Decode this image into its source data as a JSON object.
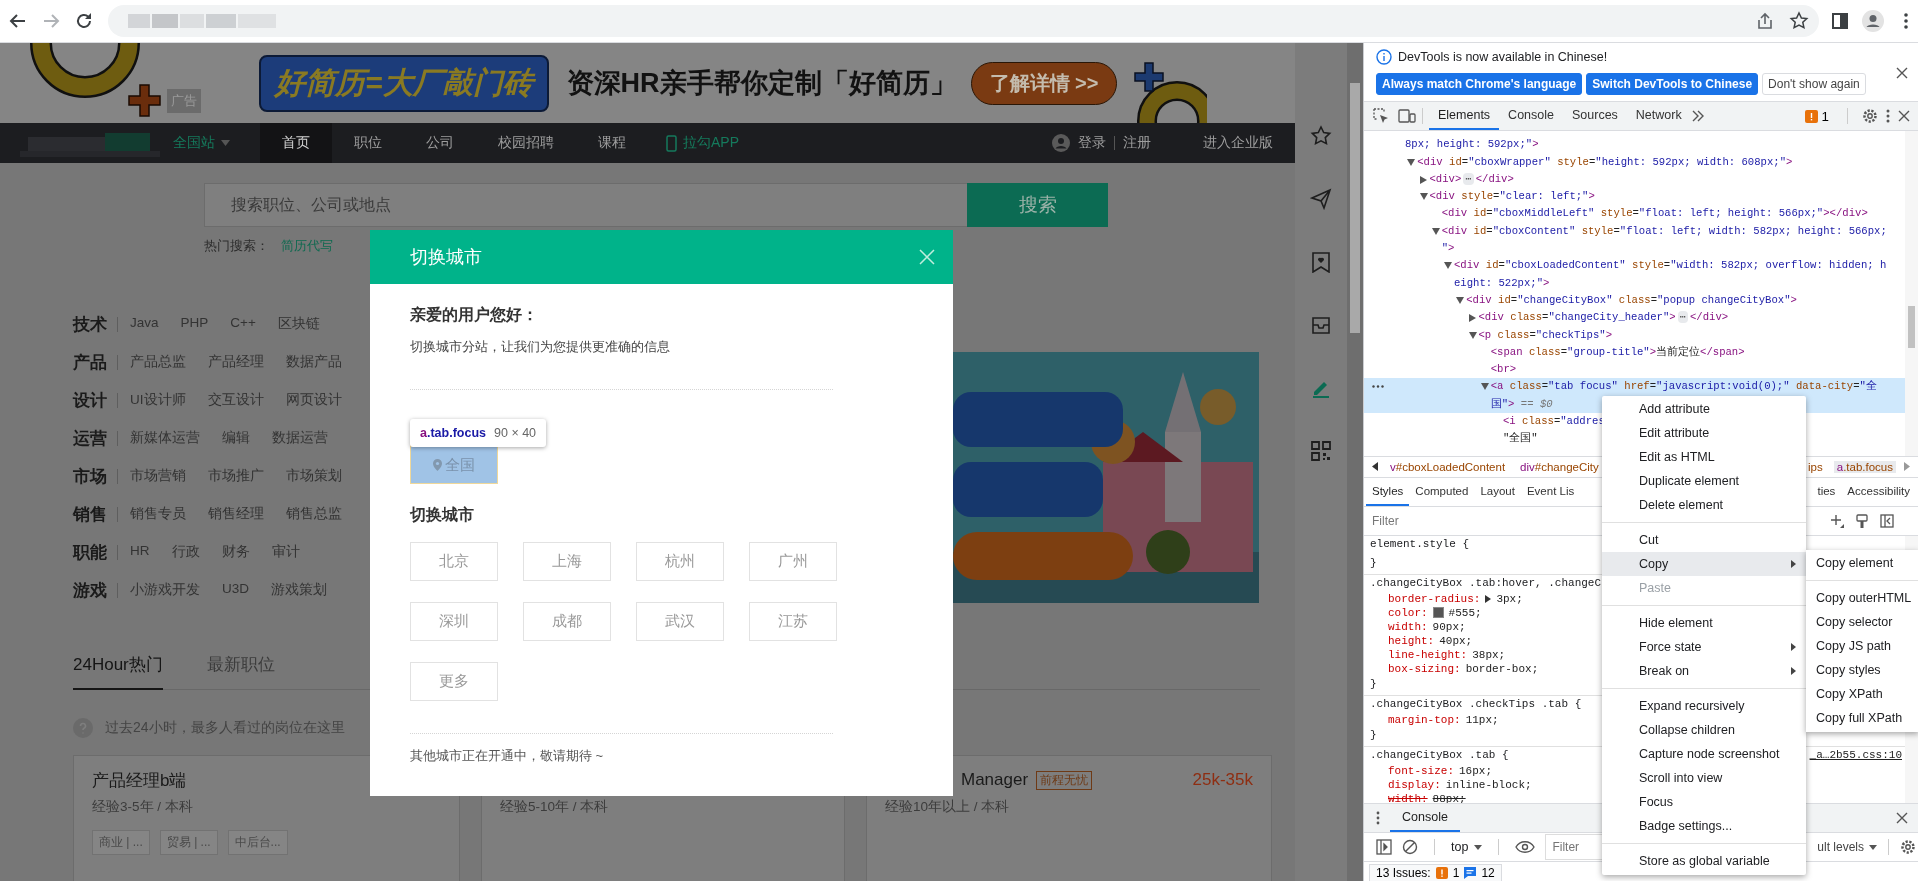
{
  "ad_banner": {
    "badge": "广告",
    "slogan": "好简历=大厂敲门砖",
    "headline": "资深HR亲手帮你定制「好简历」",
    "cta": "了解详情 >>"
  },
  "nav": {
    "city": {
      "label": "全国站",
      "expanded": false
    },
    "items": [
      {
        "label": "首页",
        "selected": true
      },
      {
        "label": "职位",
        "selected": false
      },
      {
        "label": "公司",
        "selected": false
      },
      {
        "label": "校园招聘",
        "selected": false
      },
      {
        "label": "课程",
        "selected": false
      }
    ],
    "app_link": "拉勾APP",
    "login": "登录",
    "register": "注册",
    "enterprise": "进入企业版"
  },
  "search": {
    "placeholder": "搜索职位、公司或地点",
    "button": "搜索",
    "hot_label": "热门搜索：",
    "hot_terms": [
      "简历代写"
    ]
  },
  "categories": [
    {
      "name": "技术",
      "items": [
        "Java",
        "PHP",
        "C++",
        "区块链"
      ]
    },
    {
      "name": "产品",
      "items": [
        "产品总监",
        "产品经理",
        "数据产品"
      ]
    },
    {
      "name": "设计",
      "items": [
        "UI设计师",
        "交互设计",
        "网页设计"
      ]
    },
    {
      "name": "运营",
      "items": [
        "新媒体运营",
        "编辑",
        "数据运营"
      ]
    },
    {
      "name": "市场",
      "items": [
        "市场营销",
        "市场推广",
        "市场策划"
      ]
    },
    {
      "name": "销售",
      "items": [
        "销售专员",
        "销售经理",
        "销售总监"
      ]
    },
    {
      "name": "职能",
      "items": [
        "HR",
        "行政",
        "财务",
        "审计"
      ]
    },
    {
      "name": "游戏",
      "items": [
        "小游戏开发",
        "U3D",
        "游戏策划"
      ]
    }
  ],
  "job_tabs": [
    {
      "label": "24Hour热门",
      "selected": true
    },
    {
      "label": "最新职位",
      "selected": false
    }
  ],
  "hot_tip": "过去24小时，最多人看过的岗位在这里",
  "jobs": [
    {
      "title": "产品经理b端",
      "experience": "经验3-5年 / 本科",
      "tags": [
        "商业 | ...",
        "贸易 | ...",
        "中后台..."
      ]
    },
    {
      "experience": "经验5-10年 / 本科"
    },
    {
      "title": "Manager",
      "source": "前程无忧",
      "salary": "25k-35k",
      "experience": "经验10年以上 / 本科"
    }
  ],
  "modal": {
    "title": "切换城市",
    "greeting": "亲爱的用户您好：",
    "intro": "切换城市分站，让我们为您提供更准确的信息",
    "current": {
      "label": "全国",
      "highlighted": true
    },
    "cities_title": "切换城市",
    "cities": [
      "北京",
      "上海",
      "杭州",
      "广州",
      "深圳",
      "成都",
      "武汉",
      "江苏",
      "更多"
    ],
    "footer": "其他城市正在开通中，敬请期待 ~"
  },
  "inspect_tooltip": {
    "selector": "a.tab.focus",
    "size": "90 × 40"
  },
  "devtools": {
    "infobar": {
      "message": "DevTools is now available in Chinese!",
      "buttons": [
        {
          "label": "Always match Chrome's language",
          "kind": "primary"
        },
        {
          "label": "Switch DevTools to Chinese",
          "kind": "primary"
        },
        {
          "label": "Don't show again",
          "kind": "secondary"
        }
      ]
    },
    "tabs": [
      {
        "label": "Elements",
        "selected": true
      },
      {
        "label": "Console",
        "selected": false
      },
      {
        "label": "Sources",
        "selected": false
      },
      {
        "label": "Network",
        "selected": false
      }
    ],
    "issues_count": "1",
    "dom_tree": {
      "selected": false,
      "wrap": [
        {
          "kind": "value",
          "text": "8px; height: 592px;\""
        },
        {
          "kind": "tag",
          "text": ">"
        }
      ],
      "children": [
        {
          "selected": false,
          "expanded": true,
          "head": [
            {
              "kind": "tag",
              "text": "<div"
            },
            {
              "kind": "attr",
              "text": " id"
            },
            {
              "kind": "text",
              "text": "="
            },
            {
              "kind": "value",
              "text": "\"cboxWrapper\""
            },
            {
              "kind": "attr",
              "text": " style"
            },
            {
              "kind": "text",
              "text": "="
            },
            {
              "kind": "value",
              "text": "\"height: 592px; width: 608px;\""
            },
            {
              "kind": "tag",
              "text": ">"
            }
          ],
          "children": [
            {
              "selected": false,
              "expanded": false,
              "head": [
                {
                  "kind": "tag",
                  "text": "<div>"
                },
                {
                  "kind": "ellipsis",
                  "text": "⋯"
                },
                {
                  "kind": "tag",
                  "text": "</div>"
                }
              ]
            },
            {
              "selected": false,
              "expanded": true,
              "head": [
                {
                  "kind": "tag",
                  "text": "<div"
                },
                {
                  "kind": "attr",
                  "text": " style"
                },
                {
                  "kind": "text",
                  "text": "="
                },
                {
                  "kind": "value",
                  "text": "\"clear: left;\""
                },
                {
                  "kind": "tag",
                  "text": ">"
                }
              ],
              "children": [
                {
                  "selected": false,
                  "head": [
                    {
                      "kind": "tag",
                      "text": "<div"
                    },
                    {
                      "kind": "attr",
                      "text": " id"
                    },
                    {
                      "kind": "text",
                      "text": "="
                    },
                    {
                      "kind": "value",
                      "text": "\"cboxMiddleLeft\""
                    },
                    {
                      "kind": "attr",
                      "text": " style"
                    },
                    {
                      "kind": "text",
                      "text": "="
                    },
                    {
                      "kind": "value",
                      "text": "\"float: left; height: 566px;\""
                    },
                    {
                      "kind": "tag",
                      "text": "></div>"
                    }
                  ]
                },
                {
                  "selected": false,
                  "expanded": true,
                  "head": [
                    {
                      "kind": "tag",
                      "text": "<div"
                    },
                    {
                      "kind": "attr",
                      "text": " id"
                    },
                    {
                      "kind": "text",
                      "text": "="
                    },
                    {
                      "kind": "value",
                      "text": "\"cboxContent\""
                    },
                    {
                      "kind": "attr",
                      "text": " style"
                    },
                    {
                      "kind": "text",
                      "text": "="
                    },
                    {
                      "kind": "value",
                      "text": "\"float: left; width: 582px; height: 566px;"
                    }
                  ],
                  "wrap": [
                    {
                      "kind": "value",
                      "text": "\""
                    },
                    {
                      "kind": "tag",
                      "text": ">"
                    }
                  ],
                  "children": [
                    {
                      "selected": false,
                      "expanded": true,
                      "head": [
                        {
                          "kind": "tag",
                          "text": "<div"
                        },
                        {
                          "kind": "attr",
                          "text": " id"
                        },
                        {
                          "kind": "text",
                          "text": "="
                        },
                        {
                          "kind": "value",
                          "text": "\"cboxLoadedContent\""
                        },
                        {
                          "kind": "attr",
                          "text": " style"
                        },
                        {
                          "kind": "text",
                          "text": "="
                        },
                        {
                          "kind": "value",
                          "text": "\"width: 582px; overflow: hidden; h"
                        }
                      ],
                      "wrap": [
                        {
                          "kind": "value",
                          "text": "eight: 522px;\""
                        },
                        {
                          "kind": "tag",
                          "text": ">"
                        }
                      ],
                      "children": [
                        {
                          "selected": false,
                          "expanded": true,
                          "head": [
                            {
                              "kind": "tag",
                              "text": "<div"
                            },
                            {
                              "kind": "attr",
                              "text": " id"
                            },
                            {
                              "kind": "text",
                              "text": "="
                            },
                            {
                              "kind": "value",
                              "text": "\"changeCityBox\""
                            },
                            {
                              "kind": "attr",
                              "text": " class"
                            },
                            {
                              "kind": "text",
                              "text": "="
                            },
                            {
                              "kind": "value",
                              "text": "\"popup changeCityBox\""
                            },
                            {
                              "kind": "tag",
                              "text": ">"
                            }
                          ],
                          "children": [
                            {
                              "selected": false,
                              "expanded": false,
                              "head": [
                                {
                                  "kind": "tag",
                                  "text": "<div"
                                },
                                {
                                  "kind": "attr",
                                  "text": " class"
                                },
                                {
                                  "kind": "text",
                                  "text": "="
                                },
                                {
                                  "kind": "value",
                                  "text": "\"changeCity_header\""
                                },
                                {
                                  "kind": "tag",
                                  "text": ">"
                                },
                                {
                                  "kind": "ellipsis",
                                  "text": "⋯"
                                },
                                {
                                  "kind": "tag",
                                  "text": "</div>"
                                }
                              ]
                            },
                            {
                              "selected": false,
                              "expanded": true,
                              "head": [
                                {
                                  "kind": "tag",
                                  "text": "<p"
                                },
                                {
                                  "kind": "attr",
                                  "text": " class"
                                },
                                {
                                  "kind": "text",
                                  "text": "="
                                },
                                {
                                  "kind": "value",
                                  "text": "\"checkTips\""
                                },
                                {
                                  "kind": "tag",
                                  "text": ">"
                                }
                              ],
                              "children": [
                                {
                                  "selected": false,
                                  "head": [
                                    {
                                      "kind": "tag",
                                      "text": "<span"
                                    },
                                    {
                                      "kind": "attr",
                                      "text": " class"
                                    },
                                    {
                                      "kind": "text",
                                      "text": "="
                                    },
                                    {
                                      "kind": "value",
                                      "text": "\"group-title\""
                                    },
                                    {
                                      "kind": "tag",
                                      "text": ">"
                                    },
                                    {
                                      "kind": "text",
                                      "text": "当前定位"
                                    },
                                    {
                                      "kind": "tag",
                                      "text": "</span>"
                                    }
                                  ]
                                },
                                {
                                  "selected": false,
                                  "head": [
                                    {
                                      "kind": "tag",
                                      "text": "<br>"
                                    }
                                  ]
                                },
                                {
                                  "selected": true,
                                  "expanded": true,
                                  "head": [
                                    {
                                      "kind": "tag",
                                      "text": "<a"
                                    },
                                    {
                                      "kind": "attr",
                                      "text": " class"
                                    },
                                    {
                                      "kind": "text",
                                      "text": "="
                                    },
                                    {
                                      "kind": "value",
                                      "text": "\"tab focus\""
                                    },
                                    {
                                      "kind": "attr",
                                      "text": " href"
                                    },
                                    {
                                      "kind": "text",
                                      "text": "="
                                    },
                                    {
                                      "kind": "value",
                                      "text": "\"javascript:void(0);\""
                                    },
                                    {
                                      "kind": "attr",
                                      "text": " data-city"
                                    },
                                    {
                                      "kind": "text",
                                      "text": "="
                                    },
                                    {
                                      "kind": "value",
                                      "text": "\"全"
                                    }
                                  ],
                                  "wrap": [
                                    {
                                      "kind": "value",
                                      "text": "国\""
                                    },
                                    {
                                      "kind": "tag",
                                      "text": ">"
                                    },
                                    {
                                      "kind": "comment",
                                      "text": " == $0"
                                    }
                                  ],
                                  "children": [
                                    {
                                      "selected": false,
                                      "head": [
                                        {
                                          "kind": "tag",
                                          "text": "<i"
                                        },
                                        {
                                          "kind": "attr",
                                          "text": " class"
                                        },
                                        {
                                          "kind": "text",
                                          "text": "="
                                        },
                                        {
                                          "kind": "value",
                                          "text": "\"addres"
                                        }
                                      ]
                                    },
                                    {
                                      "selected": false,
                                      "head": [
                                        {
                                          "kind": "text",
                                          "text": "\"全国\""
                                        }
                                      ]
                                    }
                                  ]
                                }
                              ]
                            }
                          ]
                        }
                      ]
                    }
                  ]
                }
              ]
            }
          ]
        }
      ]
    },
    "breadcrumbs": [
      {
        "label": "v#cboxLoadedContent",
        "selected": false
      },
      {
        "label": "div#changeCity",
        "selected": false
      },
      {
        "label": "ips",
        "selected": false
      },
      {
        "label": "a.tab.focus",
        "selected": true
      }
    ],
    "style_tabs": [
      {
        "label": "Styles",
        "selected": true
      },
      {
        "label": "Computed",
        "selected": false
      },
      {
        "label": "Layout",
        "selected": false
      },
      {
        "label": "Event Lis",
        "selected": false
      },
      {
        "label": "ties",
        "selected": false
      },
      {
        "label": "Accessibility",
        "selected": false
      }
    ],
    "styles_filter": {
      "placeholder": "Filter"
    },
    "rules": [
      {
        "selector": "element.style {",
        "close": "}"
      },
      {
        "selector": ".changeCityBox .tab:hover, .changeC",
        "close": "}",
        "declarations": [
          {
            "property": "border-radius:",
            "value": "3px;",
            "kind": "expandable",
            "overridden": false
          },
          {
            "property": "color:",
            "value": "#555;",
            "kind": "color",
            "overridden": false
          },
          {
            "property": "width:",
            "value": "90px;",
            "kind": "plain",
            "overridden": false
          },
          {
            "property": "height:",
            "value": "40px;",
            "kind": "plain",
            "overridden": false
          },
          {
            "property": "line-height:",
            "value": "38px;",
            "kind": "plain",
            "overridden": false
          },
          {
            "property": "box-sizing:",
            "value": "border-box;",
            "kind": "plain",
            "overridden": false
          }
        ]
      },
      {
        "selector": ".changeCityBox .checkTips .tab {",
        "close": "}",
        "declarations": [
          {
            "property": "margin-top:",
            "value": "11px;",
            "kind": "plain",
            "overridden": false
          }
        ]
      },
      {
        "selector": ".changeCityBox .tab {",
        "source": "_a…2b55.css:10",
        "declarations": [
          {
            "property": "font-size:",
            "value": "16px;",
            "kind": "plain",
            "overridden": false
          },
          {
            "property": "display:",
            "value": "inline-block;",
            "kind": "plain",
            "overridden": false
          },
          {
            "property": "width:",
            "value": "88px;",
            "kind": "plain",
            "overridden": true
          }
        ]
      }
    ],
    "console_drawer": {
      "tab": {
        "label": "Console",
        "selected": true
      },
      "context": "top",
      "filter_placeholder": "Filter",
      "levels": "ult levels",
      "issues": {
        "label": "13 Issues:",
        "warnings": "1",
        "infos": "12"
      }
    },
    "context_menu": {
      "groups": [
        [
          {
            "label": "Add attribute",
            "highlighted": false,
            "disabled": false,
            "submenu": false
          },
          {
            "label": "Edit attribute",
            "highlighted": false,
            "disabled": false,
            "submenu": false
          },
          {
            "label": "Edit as HTML",
            "highlighted": false,
            "disabled": false,
            "submenu": false
          },
          {
            "label": "Duplicate element",
            "highlighted": false,
            "disabled": false,
            "submenu": false
          },
          {
            "label": "Delete element",
            "highlighted": false,
            "disabled": false,
            "submenu": false
          }
        ],
        [
          {
            "label": "Cut",
            "highlighted": false,
            "disabled": false,
            "submenu": false
          },
          {
            "label": "Copy",
            "highlighted": true,
            "disabled": false,
            "submenu": true
          },
          {
            "label": "Paste",
            "highlighted": false,
            "disabled": true,
            "submenu": false
          }
        ],
        [
          {
            "label": "Hide element",
            "highlighted": false,
            "disabled": false,
            "submenu": false
          },
          {
            "label": "Force state",
            "highlighted": false,
            "disabled": false,
            "submenu": true
          },
          {
            "label": "Break on",
            "highlighted": false,
            "disabled": false,
            "submenu": true
          }
        ],
        [
          {
            "label": "Expand recursively",
            "highlighted": false,
            "disabled": false,
            "submenu": false
          },
          {
            "label": "Collapse children",
            "highlighted": false,
            "disabled": false,
            "submenu": false
          },
          {
            "label": "Capture node screenshot",
            "highlighted": false,
            "disabled": false,
            "submenu": false
          },
          {
            "label": "Scroll into view",
            "highlighted": false,
            "disabled": false,
            "submenu": false
          },
          {
            "label": "Focus",
            "highlighted": false,
            "disabled": false,
            "submenu": false
          },
          {
            "label": "Badge settings...",
            "highlighted": false,
            "disabled": false,
            "submenu": false
          }
        ],
        [
          {
            "label": "Store as global variable",
            "highlighted": false,
            "disabled": false,
            "submenu": false
          }
        ]
      ]
    },
    "submenu": {
      "groups": [
        [
          "Copy element"
        ],
        [
          "Copy outerHTML",
          "Copy selector",
          "Copy JS path",
          "Copy styles",
          "Copy XPath",
          "Copy full XPath"
        ]
      ]
    }
  }
}
